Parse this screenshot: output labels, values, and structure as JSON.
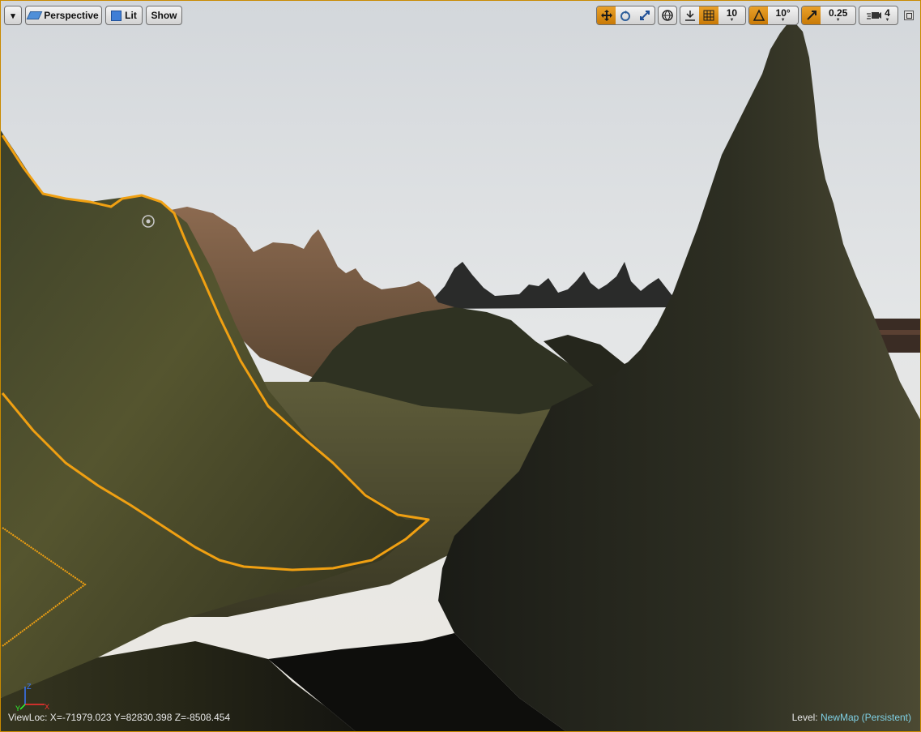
{
  "toolbar": {
    "options_caret": "▾",
    "perspective_label": "Perspective",
    "lit_label": "Lit",
    "show_label": "Show",
    "grid_snap_value": "10",
    "rotation_snap_value": "10°",
    "scale_snap_value": "0.25",
    "camera_speed_value": "4"
  },
  "status": {
    "viewloc": "ViewLoc: X=-71979.023 Y=82830.398 Z=-8508.454",
    "level_label": "Level:",
    "level_name": "NewMap (Persistent)"
  },
  "axis": {
    "z": "Z",
    "x": "X",
    "y": "Y"
  },
  "colors": {
    "accent": "#c97a06",
    "selection_outline": "#f0a012",
    "level_name": "#7fd0e4"
  },
  "icons": [
    "chevron-down-icon",
    "perspective-icon",
    "lit-cube-icon",
    "translate-icon",
    "rotate-icon",
    "scale-icon",
    "world-space-icon",
    "surface-snap-icon",
    "grid-snap-icon",
    "rotation-snap-icon",
    "scale-snap-icon",
    "camera-speed-icon",
    "maximize-icon"
  ]
}
